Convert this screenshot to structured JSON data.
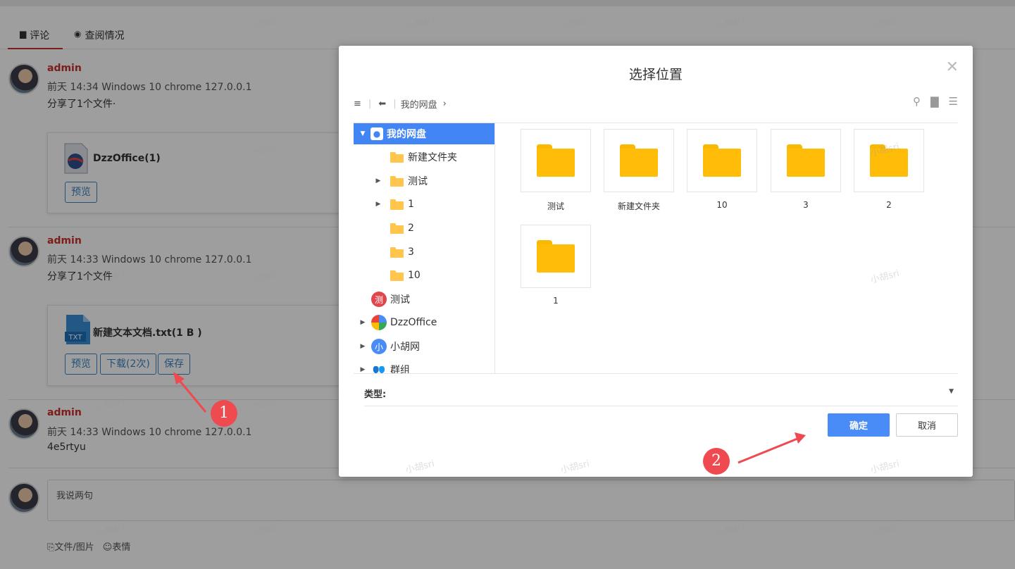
{
  "tabs": [
    {
      "label": "评论",
      "icon": "comment-icon"
    },
    {
      "label": "查阅情况",
      "icon": "eye-icon"
    }
  ],
  "comments": [
    {
      "user": "admin",
      "meta": "前天 14:34 Windows 10 chrome 127.0.0.1",
      "text": "分享了1个文件·",
      "file": {
        "name": "DzzOffice(1)",
        "buttons": [
          "预览"
        ]
      }
    },
    {
      "user": "admin",
      "meta": "前天 14:33 Windows 10 chrome 127.0.0.1",
      "text": "分享了1个文件",
      "file": {
        "name": "新建文本文档.txt(1 B )",
        "type_badge": "TXT",
        "buttons": [
          "预览",
          "下载(2次)",
          "保存"
        ]
      }
    },
    {
      "user": "admin",
      "meta": "前天 14:33 Windows 10 chrome 127.0.0.1",
      "text": "4e5rtyu"
    }
  ],
  "reply": {
    "placeholder": "我说两句",
    "tools": [
      "文件/图片",
      "表情"
    ]
  },
  "dialog": {
    "title": "选择位置",
    "breadcrumb": "我的网盘",
    "tree": [
      {
        "label": "我的网盘",
        "selected": true
      },
      {
        "label": "新建文件夹"
      },
      {
        "label": "测试"
      },
      {
        "label": "1"
      },
      {
        "label": "2"
      },
      {
        "label": "3"
      },
      {
        "label": "10"
      },
      {
        "label": "测试",
        "badge": "测",
        "badge_color": "#e0474c"
      },
      {
        "label": "DzzOffice"
      },
      {
        "label": "小胡网",
        "badge": "小",
        "badge_color": "#4a8cf7"
      },
      {
        "label": "群组"
      }
    ],
    "folders": [
      "测试",
      "新建文件夹",
      "10",
      "3",
      "2",
      "1"
    ],
    "type_label": "类型:",
    "ok_label": "确定",
    "cancel_label": "取消"
  },
  "annotations": [
    "1",
    "2"
  ],
  "watermark": "小胡sri",
  "colors": {
    "accent": "#4a8cf7",
    "username": "#c9302c",
    "annotation": "#ee4a4f",
    "folder": "#ffbd0a"
  }
}
